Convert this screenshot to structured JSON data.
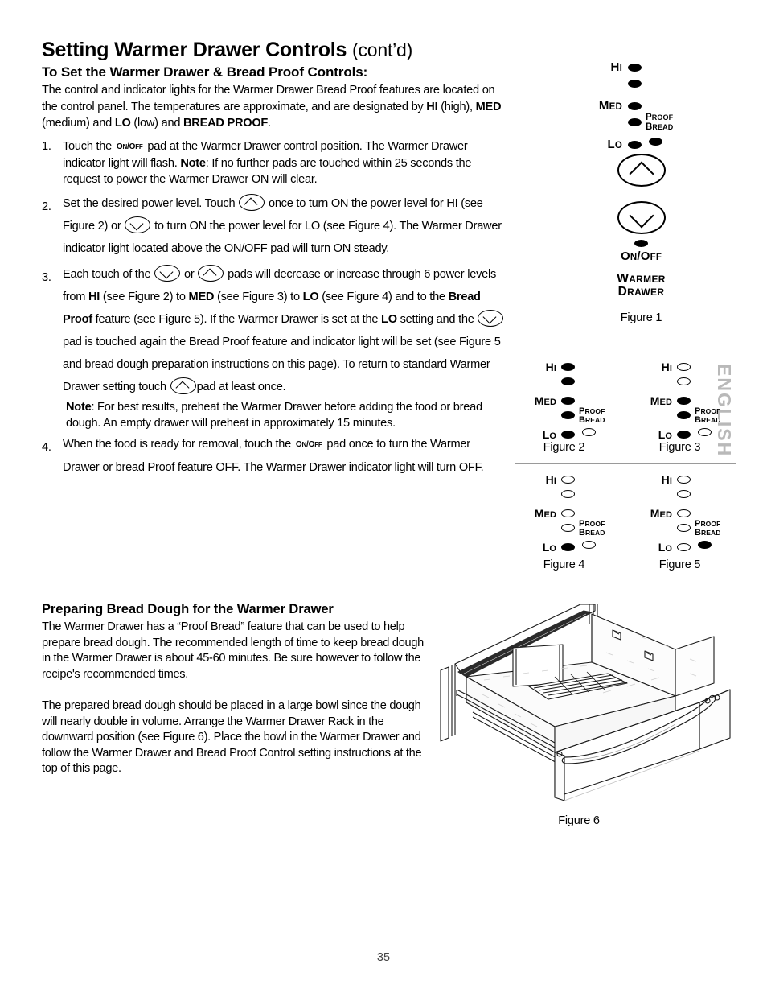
{
  "document": {
    "page_number": "35",
    "side_tab": "ENGLISH"
  },
  "heading": {
    "title": "Setting Warmer Drawer Controls",
    "title_suffix": "(cont’d)",
    "subtitle": "To Set the Warmer Drawer & Bread Proof Controls:"
  },
  "intro": {
    "part1": "The control and indicator lights for the Warmer Drawer Bread Proof features are located on the control panel. The temperatures are approximate, and are designated by ",
    "hi": "HI",
    "hi_after": " (high), ",
    "med": "MED",
    "med_after": " (medium) and ",
    "lo": "LO",
    "lo_after": " (low) and ",
    "bread_proof": "BREAD PROOF",
    "end": "."
  },
  "steps": {
    "step1": {
      "num": "1.",
      "a": "Touch the",
      "pad": "ON/OFF",
      "b": "pad at the Warmer Drawer control position. The Warmer Drawer indicator light will flash. ",
      "note_label": "Note",
      "c": ": If no further pads are touched within 25 seconds the request to power the Warmer Drawer ON will clear."
    },
    "step2": {
      "num": "2.",
      "a": "Set the desired power level. Touch",
      "b": "once to turn ON the power level for HI (see Figure 2) or",
      "c": "to turn ON the power level for LO (see Figure 4). The Warmer Drawer indicator light located above the ON/OFF pad will turn ON steady."
    },
    "step3": {
      "num": "3.",
      "a": "Each touch of the",
      "or": "or",
      "b": "pads will decrease or increase through 6 power levels from ",
      "hi": "HI",
      "c": " (see Figure 2) to ",
      "med": "MED",
      "d": " (see Figure 3) to ",
      "lo": "LO",
      "e": " (see Figure 4) and to the ",
      "bread_proof": "Bread Proof",
      "f": " feature (see Figure 5). If the Warmer Drawer is set at the ",
      "lo2": "LO",
      "g": " setting and the",
      "h": "pad is touched again the Bread Proof feature and indicator light will be set (see Figure 5 and bread dough preparation instructions on this page). To return to standard Warmer Drawer setting touch",
      "i": "pad at least once.",
      "note_label": "Note",
      "note_text": ": For best results, preheat the Warmer Drawer before adding the food or bread dough. An empty drawer will preheat in approximately 15 minutes."
    },
    "step4": {
      "num": "4.",
      "a": "When the food is ready for removal, touch the",
      "pad": "ON/OFF",
      "b": "pad once to turn the Warmer Drawer or bread Proof feature OFF. The Warmer Drawer indicator light will turn OFF."
    }
  },
  "bread_section": {
    "heading": "Preparing Bread Dough for the Warmer Drawer",
    "para1": "The Warmer Drawer has a “Proof Bread” feature that can be used to help prepare bread dough. The recommended length of time to keep bread dough in the Warmer Drawer is about 45-60 minutes. Be sure however to follow the recipe's recommended times.",
    "para2": "The prepared bread dough should be placed in a large bowl since the dough will nearly double in volume. Arrange the Warmer Drawer Rack in the downward position (see Figure 6). Place the bowl in the Warmer Drawer and follow the Warmer Drawer and Bread Proof Control setting instructions at the top of this page."
  },
  "control_labels": {
    "hi": "HI",
    "med": "MED",
    "lo": "LO",
    "proof": "PROOF",
    "bread": "BREAD",
    "on_off": "ON/OFF",
    "warmer": "WARMER",
    "drawer": "DRAWER"
  },
  "figures": {
    "figure1": {
      "caption": "Figure 1",
      "indicator_dots": [
        "on",
        "on",
        "on",
        "on",
        "on"
      ],
      "proof_dot": "on",
      "buttons": [
        "up-chevron",
        "down-chevron"
      ],
      "onoff_dot": "on"
    },
    "figure2": {
      "caption": "Figure 2",
      "setting": "HI",
      "indicator_dots": [
        "on",
        "on",
        "on",
        "on",
        "on"
      ],
      "proof_dot": "off"
    },
    "figure3": {
      "caption": "Figure 3",
      "setting": "MED",
      "indicator_dots": [
        "off",
        "off",
        "on",
        "on",
        "on"
      ],
      "proof_dot": "off"
    },
    "figure4": {
      "caption": "Figure 4",
      "setting": "LO",
      "indicator_dots": [
        "off",
        "off",
        "off",
        "off",
        "on"
      ],
      "proof_dot": "off"
    },
    "figure5": {
      "caption": "Figure 5",
      "setting": "BREAD PROOF",
      "indicator_dots": [
        "off",
        "off",
        "off",
        "off",
        "off"
      ],
      "proof_dot": "on"
    },
    "figure6": {
      "caption": "Figure 6",
      "description": "Open warmer drawer with rack in downward position"
    }
  }
}
